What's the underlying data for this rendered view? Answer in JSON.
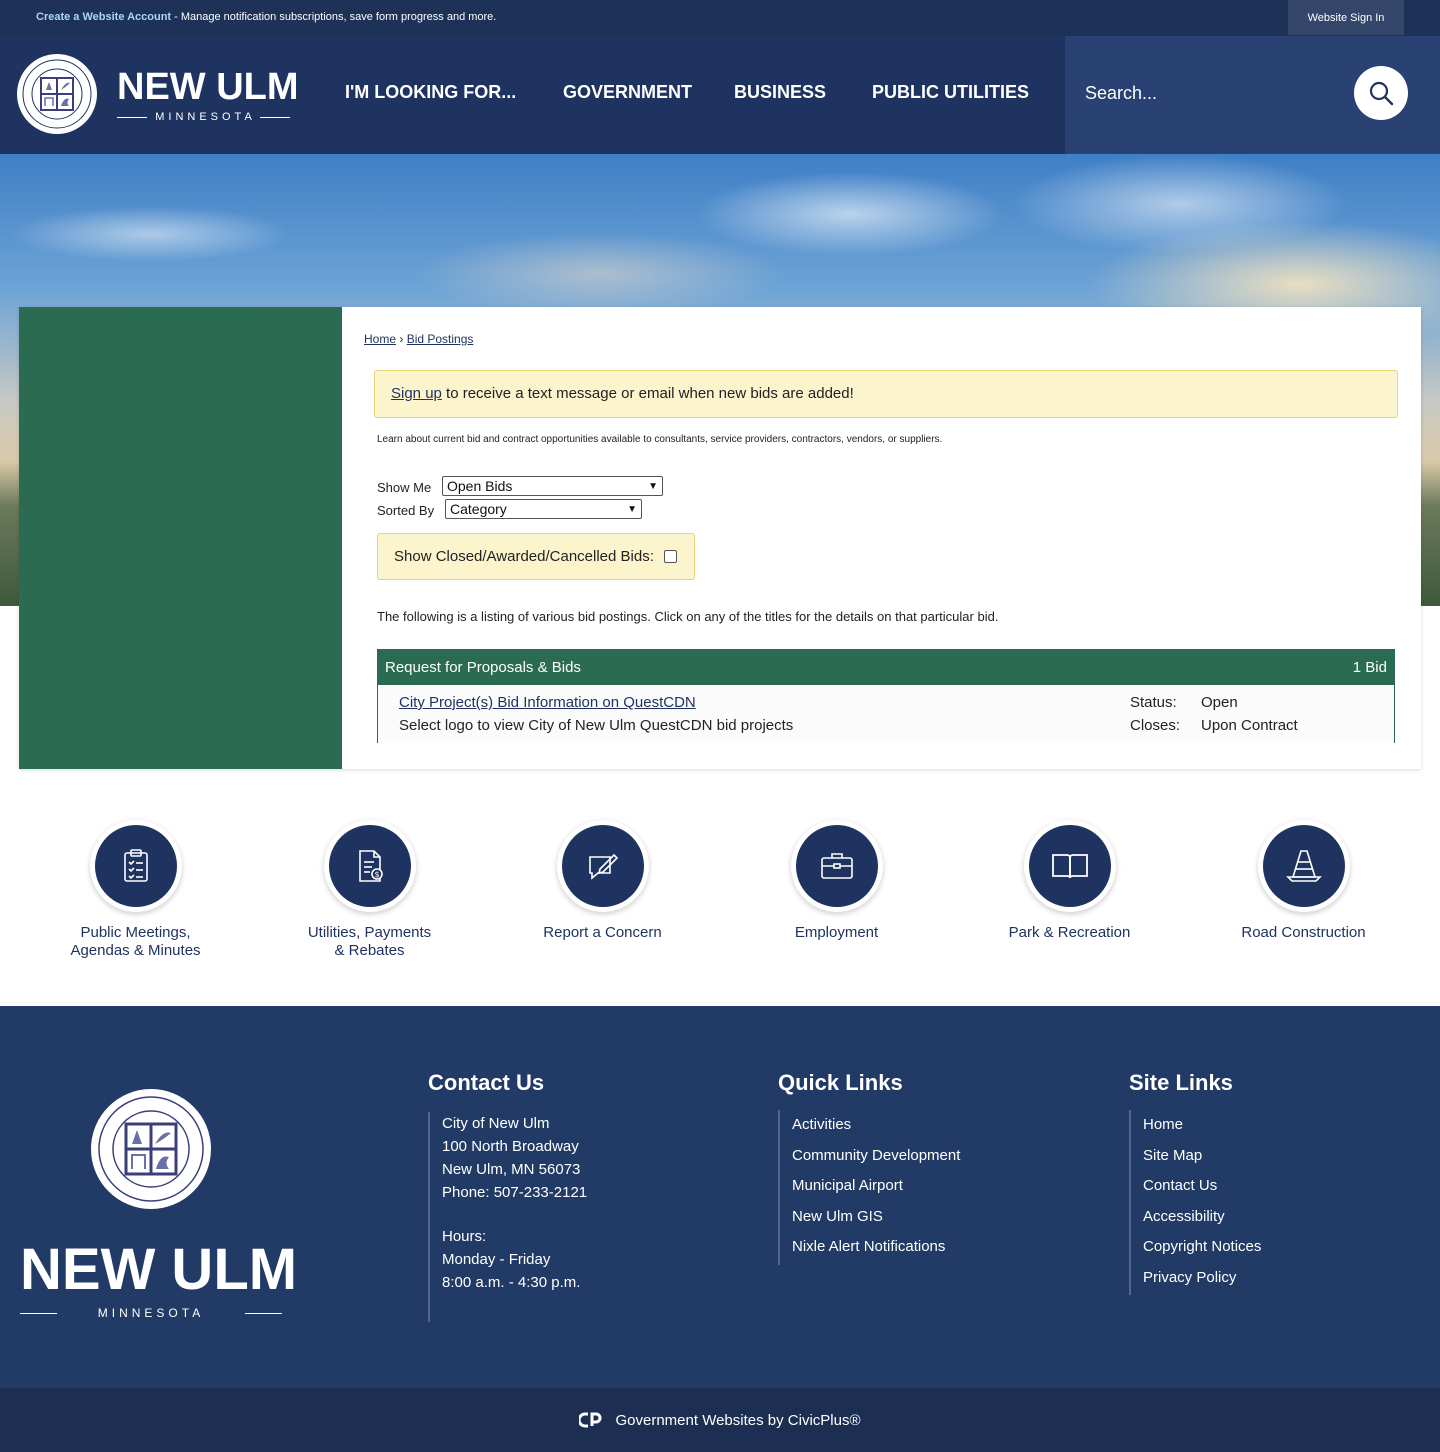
{
  "topbar": {
    "create_link": "Create a Website Account",
    "create_text": " - Manage notification subscriptions, save form progress and more.",
    "signin": "Website Sign In"
  },
  "header": {
    "brand": "NEW ULM",
    "brand_sub": "MINNESOTA",
    "nav": [
      "I'M LOOKING FOR...",
      "GOVERNMENT",
      "BUSINESS",
      "PUBLIC UTILITIES"
    ],
    "search_placeholder": "Search..."
  },
  "breadcrumb": {
    "home": "Home",
    "sep": " › ",
    "current": "Bid Postings"
  },
  "signup_alert": {
    "link": "Sign up",
    "text": " to receive a text message or email when new bids are added!"
  },
  "intro": "Learn about current bid and contract opportunities available to consultants, service providers, contractors, vendors, or suppliers.",
  "filters": {
    "show_me_label": "Show Me",
    "show_me_value": "Open Bids",
    "sorted_by_label": "Sorted By",
    "sorted_by_value": "Category",
    "closed_label": "Show Closed/Awarded/Cancelled Bids:"
  },
  "listing_note": "The following is a listing of various bid postings. Click on any of the titles for the details on that particular bid.",
  "bid_table": {
    "category": "Request for Proposals & Bids",
    "count": "1 Bid",
    "rows": [
      {
        "title": "City Project(s) Bid Information on QuestCDN",
        "description": "Select logo to view City of New Ulm QuestCDN bid projects",
        "status_label": "Status:",
        "status": "Open",
        "closes_label": "Closes:",
        "closes": "Upon Contract"
      }
    ]
  },
  "quick_links": [
    {
      "line1": "Public Meetings,",
      "line2": "Agendas & Minutes",
      "icon": "clipboard-checklist-icon"
    },
    {
      "line1": "Utilities, Payments",
      "line2": "& Rebates",
      "icon": "bill-document-icon"
    },
    {
      "line1": "Report a Concern",
      "line2": "",
      "icon": "report-pencil-icon"
    },
    {
      "line1": "Employment",
      "line2": "",
      "icon": "briefcase-icon"
    },
    {
      "line1": "Park & Recreation",
      "line2": "",
      "icon": "open-book-icon"
    },
    {
      "line1": "Road Construction",
      "line2": "",
      "icon": "traffic-cone-icon"
    }
  ],
  "footer": {
    "brand": "NEW ULM",
    "brand_sub": "MINNESOTA",
    "contact": {
      "title": "Contact Us",
      "lines": [
        "City of New Ulm",
        "100 North Broadway",
        "New Ulm, MN 56073",
        "Phone: 507-233-2121",
        "",
        "Hours:",
        "Monday - Friday",
        "8:00 a.m. - 4:30 p.m."
      ]
    },
    "quick_links": {
      "title": "Quick Links",
      "items": [
        "Activities",
        "Community Development",
        "Municipal Airport",
        "New Ulm GIS",
        "Nixle Alert Notifications"
      ]
    },
    "site_links": {
      "title": "Site Links",
      "items": [
        "Home",
        "Site Map",
        "Contact Us",
        "Accessibility",
        "Copyright Notices",
        "Privacy Policy"
      ]
    }
  },
  "credit": "Government Websites by CivicPlus®",
  "colors": {
    "navy": "#1f3360",
    "green": "#2a6b52",
    "alert": "#fcf4cc"
  }
}
